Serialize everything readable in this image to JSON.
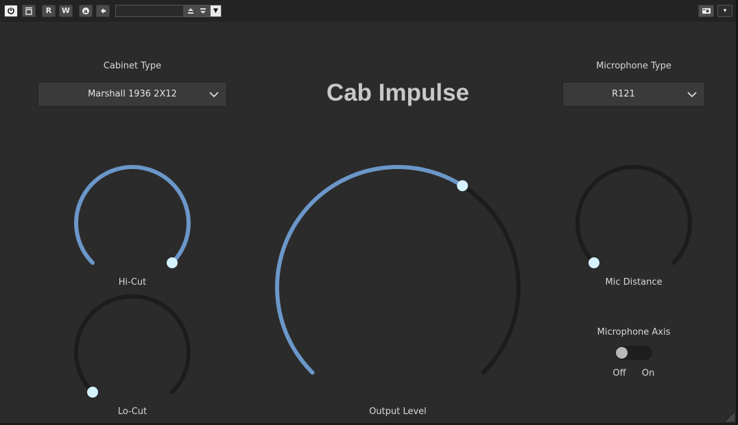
{
  "toolbar": {
    "buttons": [
      "power",
      "bypass",
      "R",
      "W",
      "a",
      "back"
    ],
    "preset_field": "",
    "right_drop": "▾"
  },
  "title": "Cab Impulse",
  "cabinet": {
    "label": "Cabinet Type",
    "value": "Marshall 1936 2X12"
  },
  "microphone": {
    "label": "Microphone Type",
    "value": "R121"
  },
  "knobs": {
    "hi_cut": {
      "label": "Hi-Cut",
      "value": 1.0
    },
    "lo_cut": {
      "label": "Lo-Cut",
      "value": 0.0
    },
    "output": {
      "label": "Output Level",
      "value": 0.62
    },
    "mic_distance": {
      "label": "Mic Distance",
      "value": 0.0
    }
  },
  "mic_axis": {
    "label": "Microphone Axis",
    "off_label": "Off",
    "on_label": "On",
    "state": "Off"
  },
  "colors": {
    "accent": "#6b97c9",
    "track": "#1c1c1c",
    "thumb": "#d4f3ff",
    "background": "#2b2b2b"
  }
}
